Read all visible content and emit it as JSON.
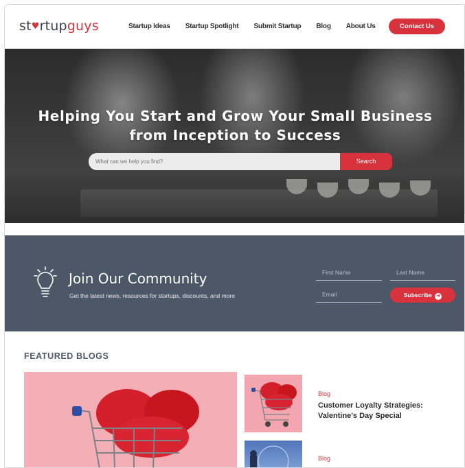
{
  "header": {
    "logo_part1": "st",
    "logo_heart": "♥",
    "logo_part2": "rtup",
    "logo_part3": "guys",
    "nav": [
      "Startup Ideas",
      "Startup Spotlight",
      "Submit Startup",
      "Blog",
      "About Us"
    ],
    "contact_label": "Contact Us"
  },
  "hero": {
    "title_line1": "Helping You Start and Grow Your Small Business",
    "title_line2": "from Inception to Success",
    "search_placeholder": "What can we help you find?",
    "search_button": "Search"
  },
  "community": {
    "title": "Join Our Community",
    "subtitle": "Get the latest news, resources for startups, discounts, and more",
    "first_name_placeholder": "First Name",
    "last_name_placeholder": "Last Name",
    "email_placeholder": "Email",
    "subscribe_label": "Subscribe",
    "subscribe_icon": "➔"
  },
  "featured": {
    "section_title": "FEATURED BLOGS",
    "posts": [
      {
        "category": "Blog",
        "title": "Customer Loyalty Strategies: Valentine's Day Special"
      },
      {
        "category": "Blog",
        "title": ""
      }
    ]
  },
  "colors": {
    "accent": "#d8323c",
    "community_bg": "#4c5767"
  }
}
